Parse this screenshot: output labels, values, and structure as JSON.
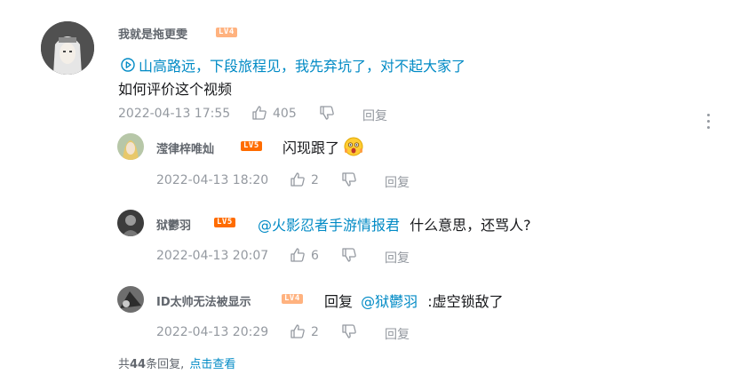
{
  "main_comment": {
    "username": "我就是拖更雯",
    "level": "LV4",
    "video_link": "山高路远，下段旅程见，我先弃坑了，对不起大家了",
    "content": "如何评价这个视频",
    "time": "2022-04-13 17:55",
    "likes": "405",
    "reply_label": "回复"
  },
  "replies": [
    {
      "username": "滢律梓唯灿",
      "level": "LV5",
      "content": "闪现跟了",
      "time": "2022-04-13 18:20",
      "likes": "2",
      "reply_label": "回复"
    },
    {
      "username": "狱鬱羽",
      "level": "LV5",
      "mention": "@火影忍者手游情报君",
      "content": "什么意思，还骂人?",
      "time": "2022-04-13 20:07",
      "likes": "6",
      "reply_label": "回复"
    },
    {
      "username": "ID太帅无法被显示",
      "level": "LV4",
      "reply_prefix": "回复",
      "mention": "@狱鬱羽",
      "content": ":虚空锁敌了",
      "time": "2022-04-13 20:29",
      "likes": "2",
      "reply_label": "回复"
    }
  ],
  "footer": {
    "prefix": "共",
    "count": "44",
    "suffix": "条回复,",
    "view_label": "点击查看"
  },
  "colors": {
    "link": "#008ac5",
    "meta": "#9499a0",
    "lv4": "#ffb27f",
    "lv5": "#ff6c00"
  }
}
